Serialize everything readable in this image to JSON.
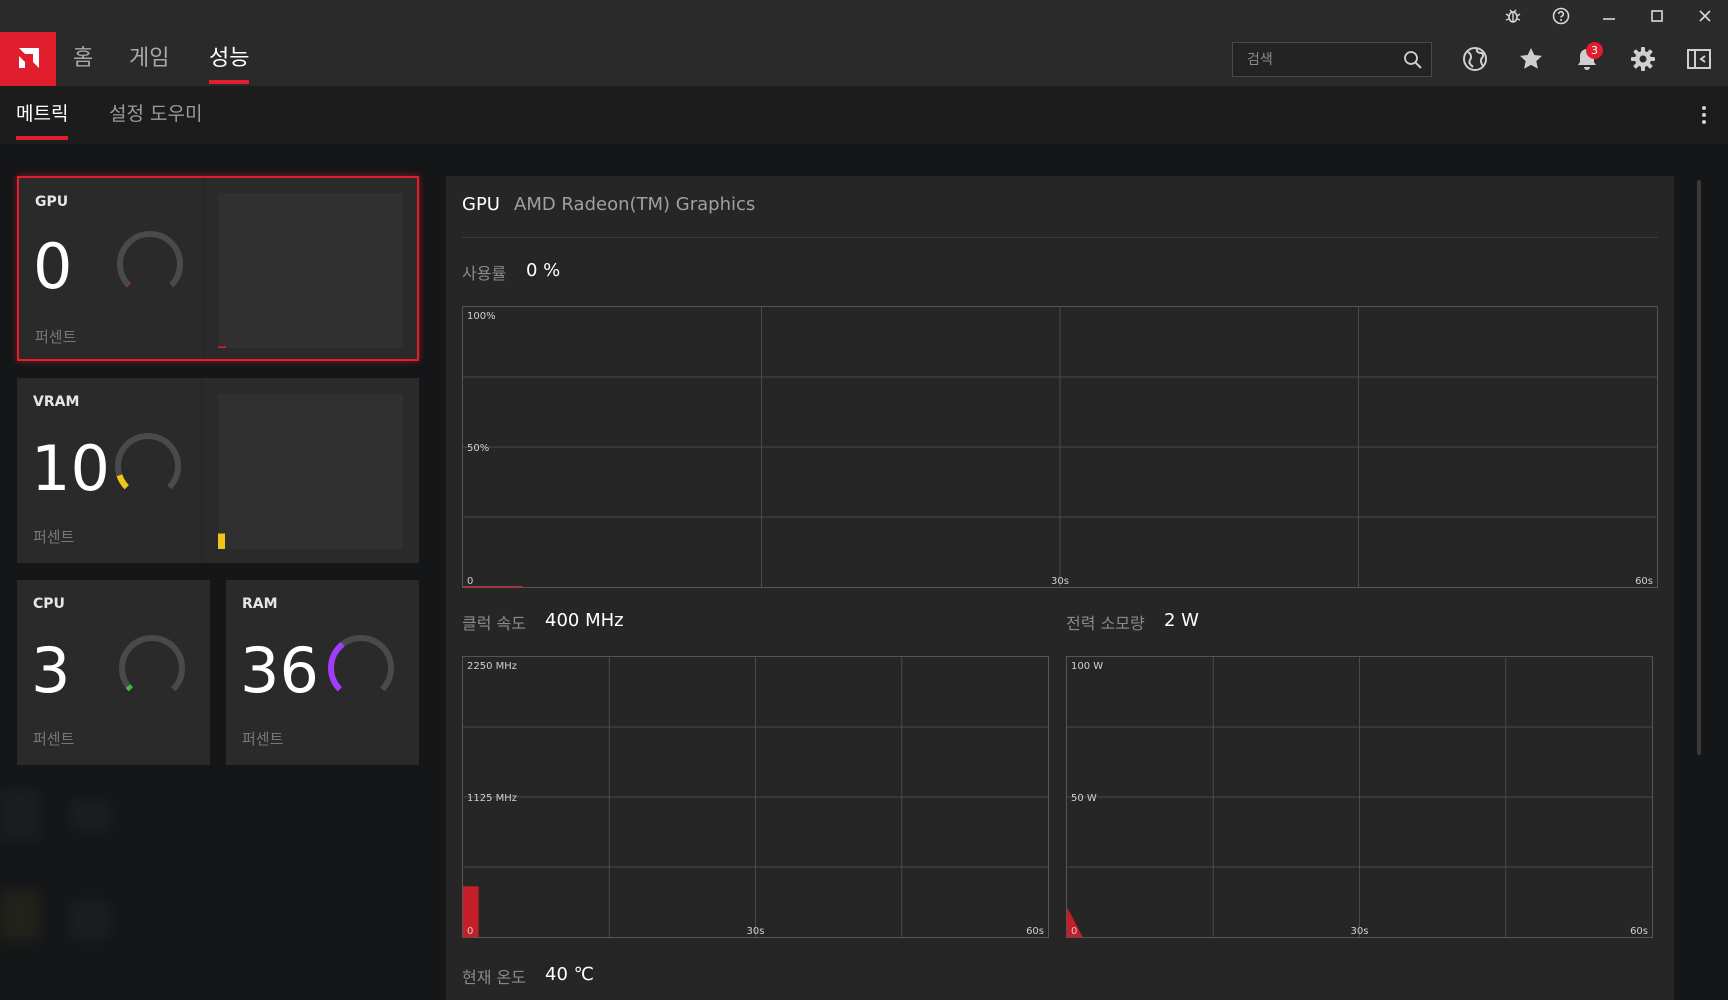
{
  "nav": {
    "tabs": [
      "홈",
      "게임",
      "성능"
    ],
    "active_tab": 2,
    "search_placeholder": "검색",
    "notification_count": "3"
  },
  "subnav": {
    "tabs": [
      "메트릭",
      "설정 도우미"
    ],
    "active_tab": 0
  },
  "cards": {
    "gpu": {
      "label": "GPU",
      "value": "0",
      "unit": "퍼센트",
      "percent": 0,
      "color": "#e11e2d"
    },
    "vram": {
      "label": "VRAM",
      "value": "10",
      "unit": "퍼센트",
      "percent": 10,
      "color": "#f0c419"
    },
    "cpu": {
      "label": "CPU",
      "value": "3",
      "unit": "퍼센트",
      "percent": 3,
      "color": "#3dbb3d"
    },
    "ram": {
      "label": "RAM",
      "value": "36",
      "unit": "퍼센트",
      "percent": 36,
      "color": "#a03cff"
    }
  },
  "detail": {
    "title": "GPU",
    "subtitle": "AMD Radeon(TM) Graphics",
    "usage": {
      "label": "사용률",
      "value": "0 %"
    },
    "clock": {
      "label": "클럭 속도",
      "value": "400 MHz"
    },
    "power": {
      "label": "전력 소모량",
      "value": "2 W"
    },
    "temp": {
      "label": "현재 온도",
      "value": "40 ℃"
    }
  },
  "chart_data": [
    {
      "type": "area",
      "name": "usage",
      "y_ticks": [
        "100%",
        "50%",
        "0"
      ],
      "x_ticks": [
        "30s",
        "60s"
      ],
      "ylim": [
        0,
        100
      ],
      "xlim": [
        0,
        60
      ],
      "grid": true,
      "color": "#e11e2d",
      "x": [
        0,
        3
      ],
      "values": [
        0,
        0
      ]
    },
    {
      "type": "area",
      "name": "clock",
      "y_ticks": [
        "2250 MHz",
        "1125 MHz",
        "0"
      ],
      "x_ticks": [
        "30s",
        "60s"
      ],
      "ylim": [
        0,
        2250
      ],
      "xlim": [
        0,
        60
      ],
      "grid": true,
      "color": "#c41e28",
      "x": [
        0,
        1.5
      ],
      "values": [
        400,
        400
      ]
    },
    {
      "type": "area",
      "name": "power",
      "y_ticks": [
        "100 W",
        "50 W",
        "0"
      ],
      "x_ticks": [
        "30s",
        "60s"
      ],
      "ylim": [
        0,
        100
      ],
      "xlim": [
        0,
        60
      ],
      "grid": true,
      "color": "#c41e28",
      "x": [
        0,
        1.5
      ],
      "values": [
        10,
        0
      ]
    }
  ]
}
